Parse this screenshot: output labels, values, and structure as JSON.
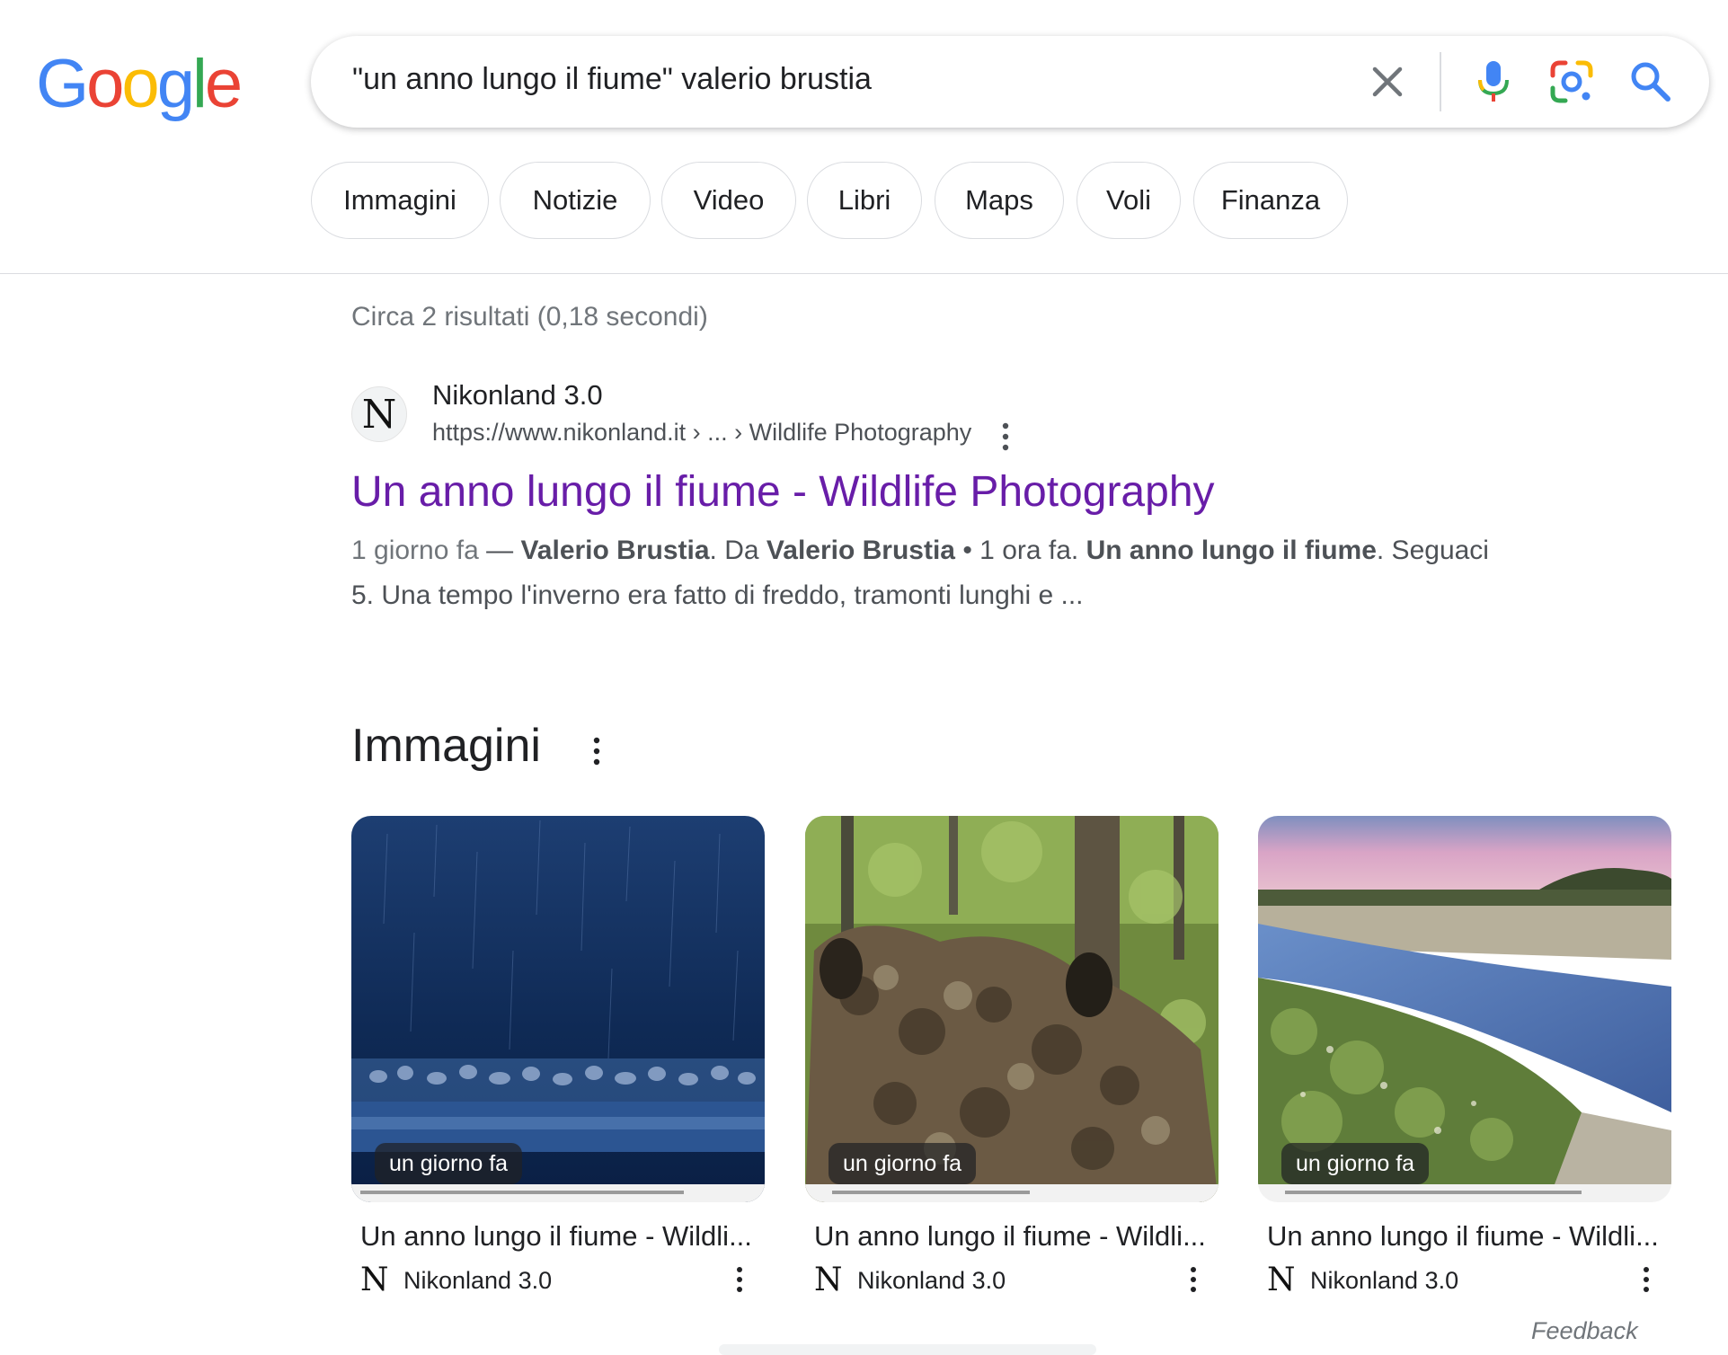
{
  "logo": {
    "text": "Google",
    "letters": [
      "G",
      "o",
      "o",
      "g",
      "l",
      "e"
    ],
    "colors": [
      "#4285F4",
      "#EA4335",
      "#FBBC05",
      "#4285F4",
      "#34A853",
      "#EA4335"
    ]
  },
  "search": {
    "query": "\"un anno lungo il fiume\" valerio brustia"
  },
  "icons": {
    "clear": "close-icon",
    "mic": "microphone-icon",
    "lens": "camera-lens-icon",
    "search": "search-icon"
  },
  "chips": [
    "Immagini",
    "Notizie",
    "Video",
    "Libri",
    "Maps",
    "Voli",
    "Finanza"
  ],
  "stats": "Circa 2 risultati (0,18 secondi)",
  "result": {
    "favicon_letter": "N",
    "site_name": "Nikonland 3.0",
    "url": "https://www.nikonland.it › ... › Wildlife Photography",
    "title": "Un anno lungo il fiume - Wildlife Photography",
    "snippet": {
      "date": "1 giorno fa",
      "dash": " — ",
      "b1": "Valerio Brustia",
      "t1": ". Da ",
      "b2": "Valerio Brustia",
      "t2": " • 1 ora fa. ",
      "b3": "Un anno lungo il fiume",
      "t3": ". Seguaci",
      "line2": "5. Una tempo l'inverno era fatto di freddo, tramonti lunghi e ..."
    }
  },
  "images_section": {
    "heading": "Immagini",
    "cards": [
      {
        "badge": "un giorno fa",
        "title": "Un anno lungo il fiume - Wildli...",
        "source_icon": "N",
        "source": "Nikonland 3.0"
      },
      {
        "badge": "un giorno fa",
        "title": "Un anno lungo il fiume - Wildli...",
        "source_icon": "N",
        "source": "Nikonland 3.0"
      },
      {
        "badge": "un giorno fa",
        "title": "Un anno lungo il fiume - Wildli...",
        "source_icon": "N",
        "source": "Nikonland 3.0"
      }
    ]
  },
  "feedback": "Feedback"
}
